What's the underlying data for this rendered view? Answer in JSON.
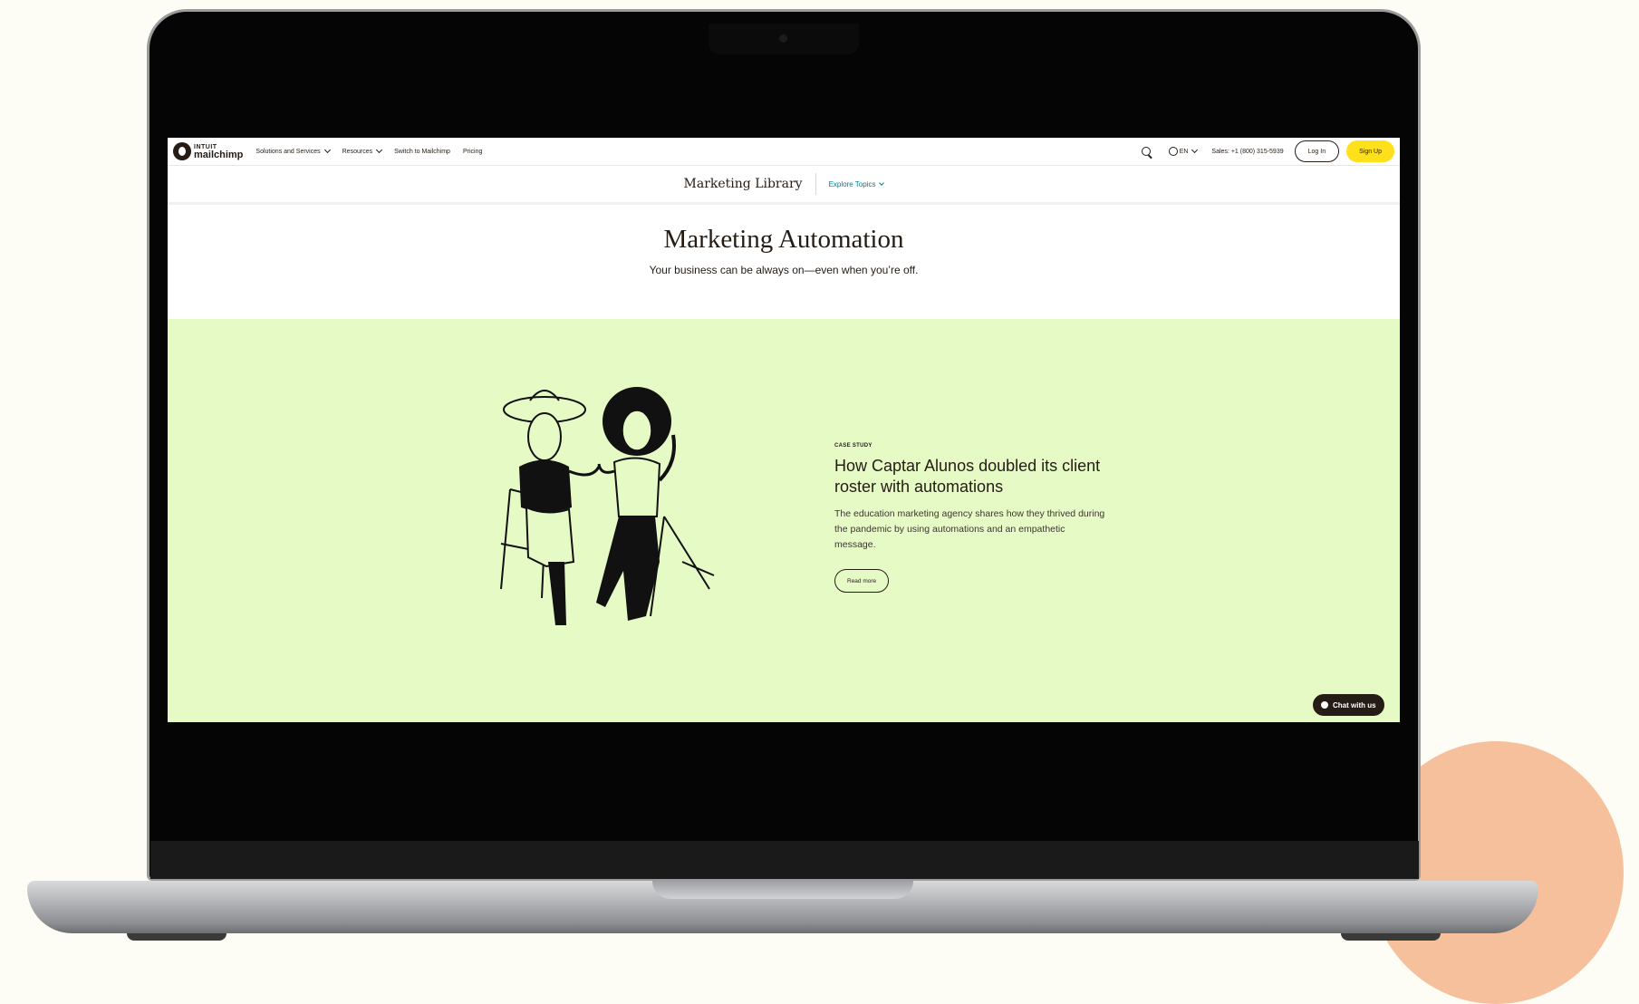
{
  "nav": {
    "logo_top": "INTUIT",
    "logo_bottom": "mailchimp",
    "items": [
      {
        "label": "Solutions and Services",
        "dropdown": true
      },
      {
        "label": "Resources",
        "dropdown": true
      },
      {
        "label": "Switch to Mailchimp",
        "dropdown": false
      },
      {
        "label": "Pricing",
        "dropdown": false
      }
    ],
    "language": "EN",
    "sales": "Sales: +1 (800) 315-5939",
    "login_label": "Log In",
    "signup_label": "Sign Up"
  },
  "subnav": {
    "title": "Marketing Library",
    "explore_label": "Explore Topics"
  },
  "hero": {
    "title": "Marketing Automation",
    "subtitle": "Your business can be always on—even when you’re off."
  },
  "feature": {
    "eyebrow": "CASE STUDY",
    "heading": "How Captar Alunos doubled its client roster with automations",
    "body": "The education marketing agency shares how they thrived during the pandemic by using automations and an empathetic message.",
    "cta_label": "Read more"
  },
  "chat": {
    "label": "Chat with us"
  },
  "colors": {
    "feature_bg": "#e6fac6",
    "signup_bg": "#ffe01b",
    "link": "#007c89",
    "decor_circle": "#f6c09d"
  }
}
